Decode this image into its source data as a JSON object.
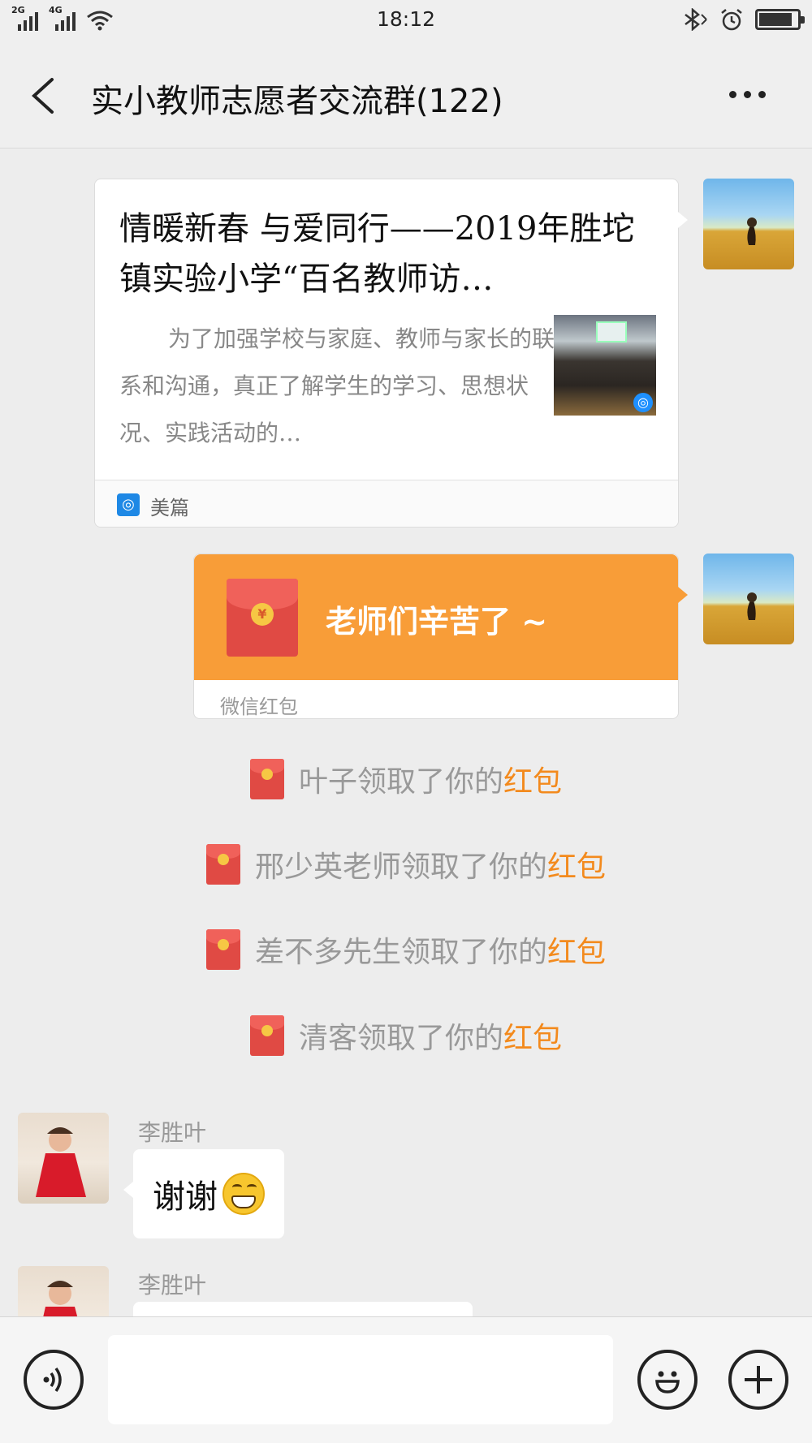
{
  "status_bar": {
    "time": "18:12",
    "signal1_label": "2G",
    "signal2_label": "4G",
    "battery_level": 0.88
  },
  "header": {
    "title": "实小教师志愿者交流群(122)"
  },
  "messages": {
    "article": {
      "title": "情暖新春 与爱同行——2019年胜坨镇实验小学“百名教师访…",
      "description": "为了加强学校与家庭、教师与家长的联系和沟通，真正了解学生的学习、思想状况、实践活动的…",
      "source": "美篇"
    },
    "red_packet": {
      "message": "老师们辛苦了 ~",
      "label": "微信红包"
    },
    "notices": [
      {
        "prefix": "叶子领取了你的",
        "highlight": "红包"
      },
      {
        "prefix": "邢少英老师领取了你的",
        "highlight": "红包"
      },
      {
        "prefix": "差不多先生领取了你的",
        "highlight": "红包"
      },
      {
        "prefix": "清客领取了你的",
        "highlight": "红包"
      }
    ],
    "incoming": [
      {
        "sender": "李胜叶",
        "text": "谢谢"
      },
      {
        "sender": "李胜叶",
        "text": ""
      }
    ]
  },
  "input": {
    "placeholder": ""
  },
  "colors": {
    "red_packet_orange": "#f89d38",
    "highlight_orange": "#f38a1d",
    "chat_background": "#ededed"
  }
}
